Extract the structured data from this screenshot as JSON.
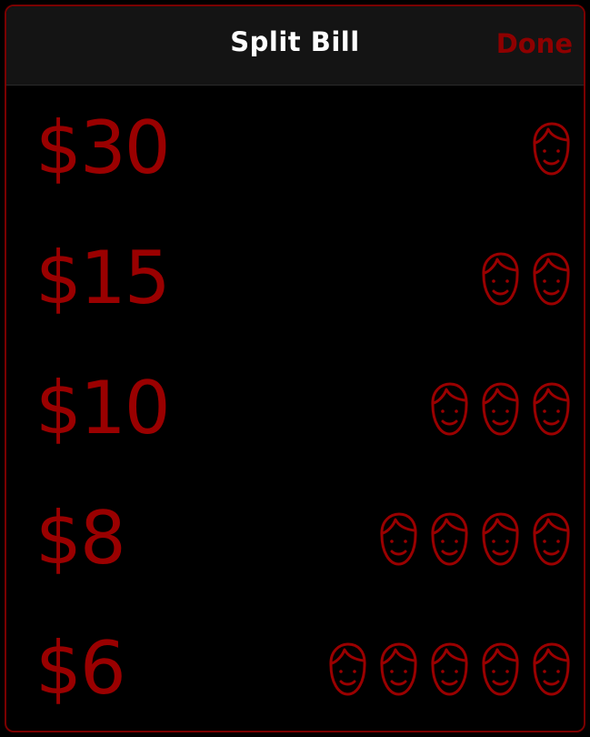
{
  "header": {
    "title": "Split Bill",
    "done_label": "Done"
  },
  "colors": {
    "accent": "#9a0000",
    "background": "#000000",
    "navbar": "#141414",
    "title": "#ffffff"
  },
  "splits": [
    {
      "amount": "$30",
      "people": 1
    },
    {
      "amount": "$15",
      "people": 2
    },
    {
      "amount": "$10",
      "people": 3
    },
    {
      "amount": "$8",
      "people": 4
    },
    {
      "amount": "$6",
      "people": 5
    }
  ],
  "icons": {
    "person": "person-face-icon"
  }
}
